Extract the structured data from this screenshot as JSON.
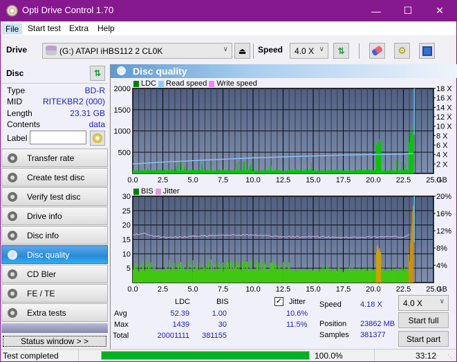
{
  "window": {
    "title": "Opti Drive Control 1.70",
    "min_icon": "minimize-icon",
    "max_icon": "maximize-icon",
    "close_icon": "close-icon"
  },
  "menu": [
    "File",
    "Start test",
    "Extra",
    "Help"
  ],
  "toolbar": {
    "drive_label": "Drive",
    "drive_value": "(G:)  ATAPI iHBS112  2 CL0K",
    "speed_label": "Speed",
    "speed_value": "4.0 X"
  },
  "disc": {
    "header": "Disc",
    "type_label": "Type",
    "type_value": "BD-R",
    "mid_label": "MID",
    "mid_value": "RITEKBR2 (000)",
    "length_label": "Length",
    "length_value": "23.31 GB",
    "contents_label": "Contents",
    "contents_value": "data",
    "label_label": "Label",
    "label_value": ""
  },
  "nav": [
    {
      "label": "Transfer rate"
    },
    {
      "label": "Create test disc"
    },
    {
      "label": "Verify test disc"
    },
    {
      "label": "Drive info"
    },
    {
      "label": "Disc info"
    },
    {
      "label": "Disc quality",
      "selected": true
    },
    {
      "label": "CD Bler"
    },
    {
      "label": "FE / TE"
    },
    {
      "label": "Extra tests"
    }
  ],
  "status_window_label": "Status window > >",
  "panel_title": "Disc quality",
  "chart_data": [
    {
      "type": "bar",
      "title": "LDC",
      "legend": [
        "LDC",
        "Read speed",
        "Write speed"
      ],
      "legend_colors": [
        "#008000",
        "#88ccff",
        "#ff80ff"
      ],
      "x_ticks": [
        "0.0",
        "2.5",
        "5.0",
        "7.5",
        "10.0",
        "12.5",
        "15.0",
        "17.5",
        "20.0",
        "22.5",
        "25.0"
      ],
      "x_unit": "GB",
      "xlim": [
        0,
        25
      ],
      "y_ticks": [
        "500",
        "1000",
        "1500",
        "2000"
      ],
      "ylim": [
        0,
        2000
      ],
      "y2_ticks": [
        "2 X",
        "4 X",
        "6 X",
        "8 X",
        "10 X",
        "12 X",
        "14 X",
        "16 X",
        "18 X"
      ],
      "y2lim": [
        0,
        18
      ],
      "ldc_approx": [
        [
          0,
          60
        ],
        [
          1,
          150
        ],
        [
          2.5,
          80
        ],
        [
          3.8,
          330
        ],
        [
          5,
          70
        ],
        [
          6.5,
          380
        ],
        [
          7,
          340
        ],
        [
          8,
          200
        ],
        [
          8.8,
          430
        ],
        [
          10,
          260
        ],
        [
          11,
          360
        ],
        [
          12.5,
          60
        ],
        [
          15,
          300
        ],
        [
          17.5,
          50
        ],
        [
          20,
          200
        ],
        [
          20.3,
          860
        ],
        [
          20.5,
          880
        ],
        [
          22.5,
          300
        ],
        [
          23,
          1000
        ],
        [
          23.2,
          1300
        ],
        [
          23.3,
          1439
        ]
      ],
      "read_speed_approx": [
        [
          0,
          2.0
        ],
        [
          2.5,
          2.4
        ],
        [
          5,
          2.7
        ],
        [
          7.5,
          3.0
        ],
        [
          10,
          3.3
        ],
        [
          12.5,
          3.5
        ],
        [
          15,
          3.7
        ],
        [
          17.5,
          3.9
        ],
        [
          20,
          4.0
        ],
        [
          22.5,
          4.1
        ],
        [
          23.3,
          4.2
        ]
      ]
    },
    {
      "type": "bar",
      "title": "BIS / Jitter",
      "legend": [
        "BIS",
        "Jitter"
      ],
      "legend_colors": [
        "#008000",
        "#d8a0d8"
      ],
      "x_ticks": [
        "0.0",
        "2.5",
        "5.0",
        "7.5",
        "10.0",
        "12.5",
        "15.0",
        "17.5",
        "20.0",
        "22.5",
        "25.0"
      ],
      "x_unit": "GB",
      "xlim": [
        0,
        25
      ],
      "y_ticks": [
        "5",
        "10",
        "15",
        "20",
        "25",
        "30"
      ],
      "ylim": [
        0,
        30
      ],
      "y2_ticks": [
        "4%",
        "8%",
        "12%",
        "16%",
        "20%"
      ],
      "y2lim": [
        0,
        20
      ],
      "bis_approx": [
        [
          0,
          5
        ],
        [
          1,
          7
        ],
        [
          2.5,
          6
        ],
        [
          3.8,
          9
        ],
        [
          5,
          5
        ],
        [
          6.5,
          8
        ],
        [
          7,
          9
        ],
        [
          8.8,
          9
        ],
        [
          10,
          10
        ],
        [
          12.5,
          4
        ],
        [
          15,
          6
        ],
        [
          17.5,
          4
        ],
        [
          20,
          6
        ],
        [
          20.3,
          14
        ],
        [
          20.5,
          13
        ],
        [
          22.5,
          4
        ],
        [
          23,
          15
        ],
        [
          23.3,
          30
        ]
      ],
      "jitter_approx": [
        [
          0,
          11.0
        ],
        [
          1,
          11.5
        ],
        [
          1.5,
          10.8
        ],
        [
          3,
          10.4
        ],
        [
          5,
          10.7
        ],
        [
          7.5,
          11.0
        ],
        [
          10,
          11.0
        ],
        [
          12.5,
          10.6
        ],
        [
          15,
          10.6
        ],
        [
          17.5,
          10.4
        ],
        [
          20,
          10.6
        ],
        [
          22.5,
          10.6
        ],
        [
          23,
          11.3
        ]
      ]
    }
  ],
  "stats": {
    "col_ldc": "LDC",
    "col_bis": "BIS",
    "jitter_label": "Jitter",
    "jitter_checked": true,
    "avg_label": "Avg",
    "avg_ldc": "52.39",
    "avg_bis": "1.00",
    "avg_jitter": "10.6%",
    "max_label": "Max",
    "max_ldc": "1439",
    "max_bis": "30",
    "max_jitter": "11.5%",
    "total_label": "Total",
    "total_ldc": "20001111",
    "total_bis": "381155",
    "speed_label": "Speed",
    "speed_value": "4.18 X",
    "position_label": "Position",
    "position_value": "23862 MB",
    "samples_label": "Samples",
    "samples_value": "381377",
    "speed_select": "4.0 X",
    "start_full": "Start full",
    "start_part": "Start part"
  },
  "statusbar": {
    "text": "Test completed",
    "progress": 100.0,
    "progress_text": "100.0%",
    "time": "33:12"
  }
}
